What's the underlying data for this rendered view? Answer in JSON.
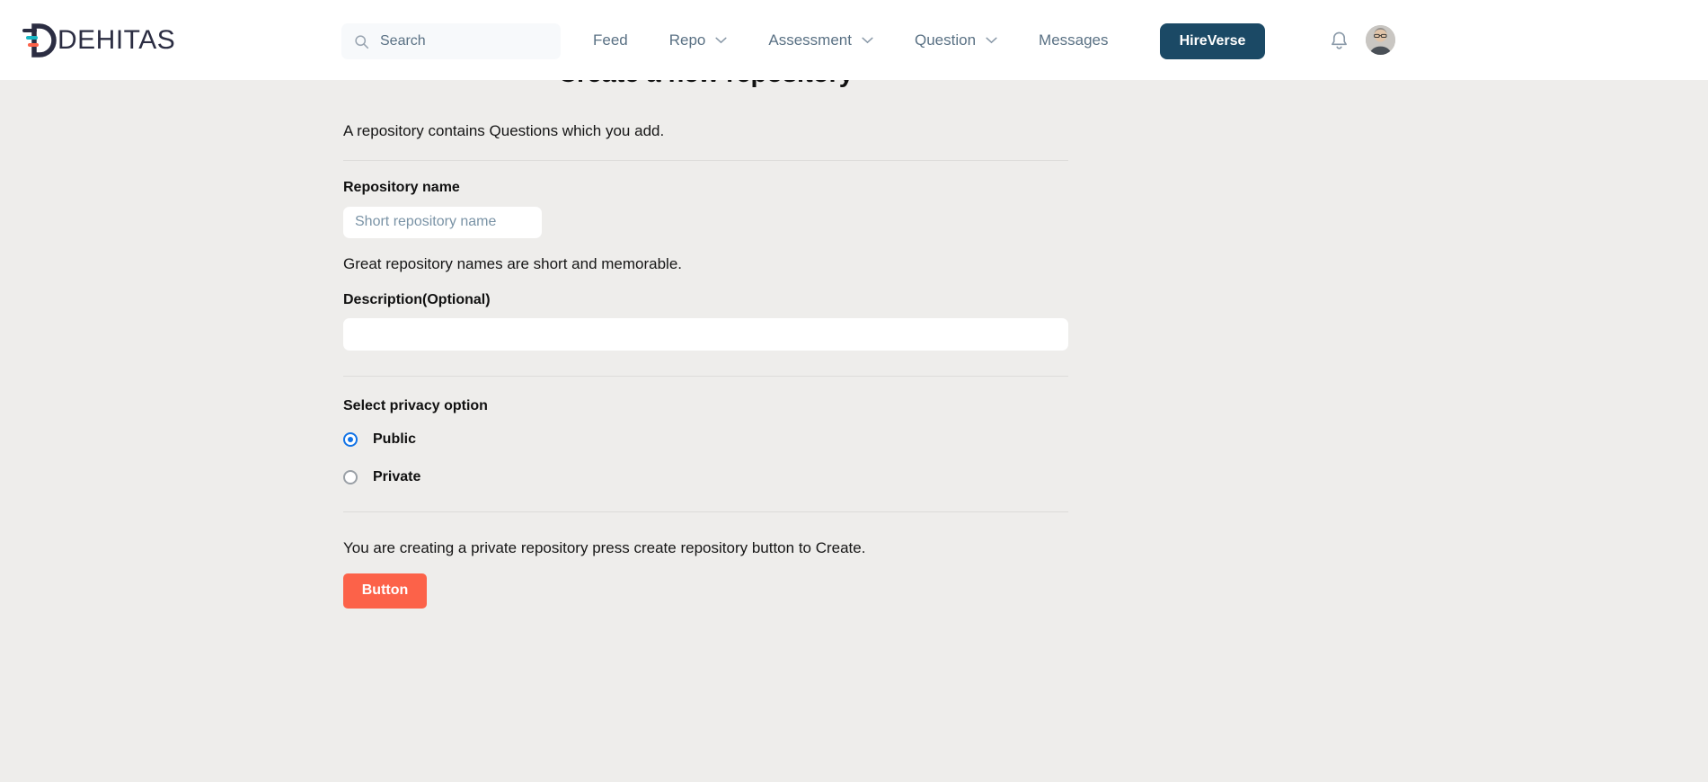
{
  "brand": {
    "name": "DEHITAS",
    "logo_icon": "dehitas-speed-d-logo",
    "color_dark": "#2b2d42",
    "color_teal": "#18b6c4",
    "color_coral": "#fc6249"
  },
  "header": {
    "search": {
      "icon": "search-icon",
      "placeholder": "Search",
      "value": ""
    },
    "nav": [
      {
        "label": "Feed",
        "has_dropdown": false
      },
      {
        "label": "Repo",
        "has_dropdown": true
      },
      {
        "label": "Assessment",
        "has_dropdown": true
      },
      {
        "label": "Question",
        "has_dropdown": true
      },
      {
        "label": "Messages",
        "has_dropdown": false
      }
    ],
    "cta": {
      "label": "HireVerse",
      "color": "#1b4965"
    },
    "notifications_icon": "bell-icon",
    "avatar_icon": "user-avatar"
  },
  "main": {
    "title": "Create a new repository",
    "intro": "A repository contains Questions which you add.",
    "repository_name": {
      "label": "Repository name",
      "placeholder": "Short repository name",
      "value": "",
      "helper": "Great repository names are short and memorable."
    },
    "description": {
      "label": "Description(Optional)",
      "placeholder": "",
      "value": ""
    },
    "privacy": {
      "label": "Select privacy option",
      "options": [
        {
          "label": "Public",
          "selected": true
        },
        {
          "label": "Private",
          "selected": false
        }
      ],
      "selected_color": "#1273e6"
    },
    "status_text": "You are creating a private repository press create repository button to Create.",
    "submit": {
      "label": "Button",
      "color": "#fc6249"
    }
  }
}
